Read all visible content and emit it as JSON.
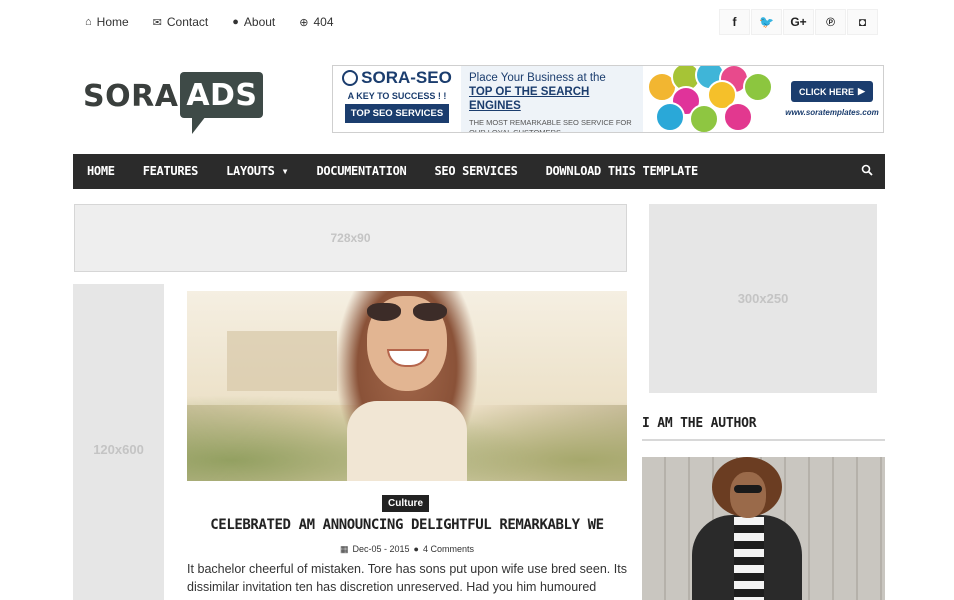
{
  "top_links": [
    {
      "label": "Home",
      "icon": "home-icon",
      "glyph": "⌂"
    },
    {
      "label": "Contact",
      "icon": "envelope-icon",
      "glyph": "✉"
    },
    {
      "label": "About",
      "icon": "user-icon",
      "glyph": "●"
    },
    {
      "label": "404",
      "icon": "lifebuoy-icon",
      "glyph": "⊕"
    }
  ],
  "socials": [
    {
      "name": "facebook-icon",
      "glyph": "f"
    },
    {
      "name": "twitter-icon",
      "glyph": "🐦"
    },
    {
      "name": "google-plus-icon",
      "glyph": "G+"
    },
    {
      "name": "pinterest-icon",
      "glyph": "℗"
    },
    {
      "name": "instagram-icon",
      "glyph": "◘"
    }
  ],
  "logo": {
    "part1": "SORA",
    "part2": "ADS"
  },
  "banner": {
    "brand": "SORA-SEO",
    "tagline": "A KEY TO SUCCESS ! !",
    "top_services": "TOP SEO SERVICES",
    "place": "Place Your Business at the",
    "engines": "TOP OF THE SEARCH ENGINES",
    "most": "THE MOST REMARKABLE SEO SERVICE FOR OUR LOYAL CUSTOMERS",
    "click": "CLICK HERE",
    "url": "www.soratemplates.com"
  },
  "nav": {
    "items": [
      "HOME",
      "FEATURES",
      "LAYOUTS ▾",
      "DOCUMENTATION",
      "SEO SERVICES",
      "DOWNLOAD THIS TEMPLATE"
    ]
  },
  "ads": {
    "leaderboard": "728x90",
    "rectangle": "300x250",
    "skyscraper": "120x600"
  },
  "post": {
    "category": "Culture",
    "title": "CELEBRATED AM ANNOUNCING DELIGHTFUL REMARKABLY WE",
    "date": "Dec-05 - 2015",
    "comments": "4 Comments",
    "excerpt": "It bachelor cheerful of mistaken. Tore has sons put upon wife use bred seen. Its dissimilar invitation ten has discretion unreserved. Had you him humoured"
  },
  "sidebar": {
    "author_title": "I AM THE AUTHOR"
  },
  "colors": {
    "nav_bg": "#2b2b2b",
    "brand_dark": "#3e4a47",
    "banner_blue": "#1b3d6e"
  }
}
